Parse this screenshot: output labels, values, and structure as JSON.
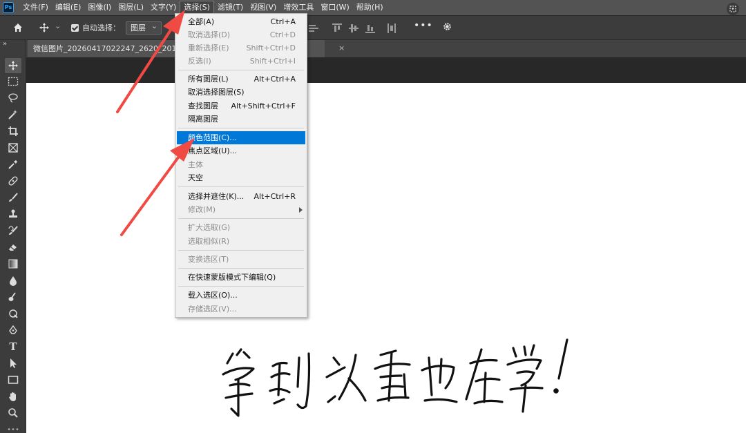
{
  "app": {
    "logo_text": "Ps"
  },
  "menubar": {
    "items": [
      {
        "label": "文件(F)"
      },
      {
        "label": "编辑(E)"
      },
      {
        "label": "图像(I)"
      },
      {
        "label": "图层(L)"
      },
      {
        "label": "文字(Y)"
      },
      {
        "label": "选择(S)"
      },
      {
        "label": "滤镜(T)"
      },
      {
        "label": "视图(V)"
      },
      {
        "label": "增效工具"
      },
      {
        "label": "窗口(W)"
      },
      {
        "label": "帮助(H)"
      }
    ],
    "active_index": 5
  },
  "options_bar": {
    "auto_select_label": "自动选择：",
    "auto_select_checked": true,
    "layer_select_value": "图层"
  },
  "document": {
    "tab_title": "微信图片_20260417022247_2620_201.jpg",
    "close_glyph": "×"
  },
  "select_menu": {
    "items": [
      {
        "label": "全部(A)",
        "shortcut": "Ctrl+A",
        "enabled": true
      },
      {
        "label": "取消选择(D)",
        "shortcut": "Ctrl+D",
        "enabled": false
      },
      {
        "label": "重新选择(E)",
        "shortcut": "Shift+Ctrl+D",
        "enabled": false
      },
      {
        "label": "反选(I)",
        "shortcut": "Shift+Ctrl+I",
        "enabled": false
      },
      {
        "label": "所有图层(L)",
        "shortcut": "Alt+Ctrl+A",
        "enabled": true
      },
      {
        "label": "取消选择图层(S)",
        "shortcut": "",
        "enabled": true
      },
      {
        "label": "查找图层",
        "shortcut": "Alt+Shift+Ctrl+F",
        "enabled": true
      },
      {
        "label": "隔离图层",
        "shortcut": "",
        "enabled": true
      },
      {
        "label": "颜色范围(C)...",
        "shortcut": "",
        "enabled": true,
        "highlighted": true
      },
      {
        "label": "焦点区域(U)...",
        "shortcut": "",
        "enabled": true
      },
      {
        "label": "主体",
        "shortcut": "",
        "enabled": false
      },
      {
        "label": "天空",
        "shortcut": "",
        "enabled": true
      },
      {
        "label": "选择并遮住(K)...",
        "shortcut": "Alt+Ctrl+R",
        "enabled": true
      },
      {
        "label": "修改(M)",
        "shortcut": "",
        "enabled": false,
        "submenu": true
      },
      {
        "label": "扩大选取(G)",
        "shortcut": "",
        "enabled": false
      },
      {
        "label": "选取相似(R)",
        "shortcut": "",
        "enabled": false
      },
      {
        "label": "变换选区(T)",
        "shortcut": "",
        "enabled": false
      },
      {
        "label": "在快速蒙版模式下编辑(Q)",
        "shortcut": "",
        "enabled": true
      },
      {
        "label": "载入选区(O)...",
        "shortcut": "",
        "enabled": true
      },
      {
        "label": "存储选区(V)...",
        "shortcut": "",
        "enabled": false
      }
    ]
  },
  "toolbar": {
    "tools": [
      "move-tool",
      "marquee-tool",
      "lasso-tool",
      "magic-wand-tool",
      "crop-tool",
      "frame-tool",
      "eyedropper-tool",
      "healing-brush-tool",
      "brush-tool",
      "clone-stamp-tool",
      "history-brush-tool",
      "eraser-tool",
      "gradient-tool",
      "blur-tool",
      "dodge-tool",
      "pen-tool",
      "type-tool",
      "path-selection-tool",
      "rectangle-tool",
      "hand-tool",
      "zoom-tool"
    ],
    "type_tool_glyph": "T"
  },
  "annotations": {
    "arrow_color": "#f04a45"
  },
  "colors": {
    "menu_highlight": "#0078d7",
    "ui_dark": "#3c3c3c",
    "ui_mid": "#535353"
  }
}
